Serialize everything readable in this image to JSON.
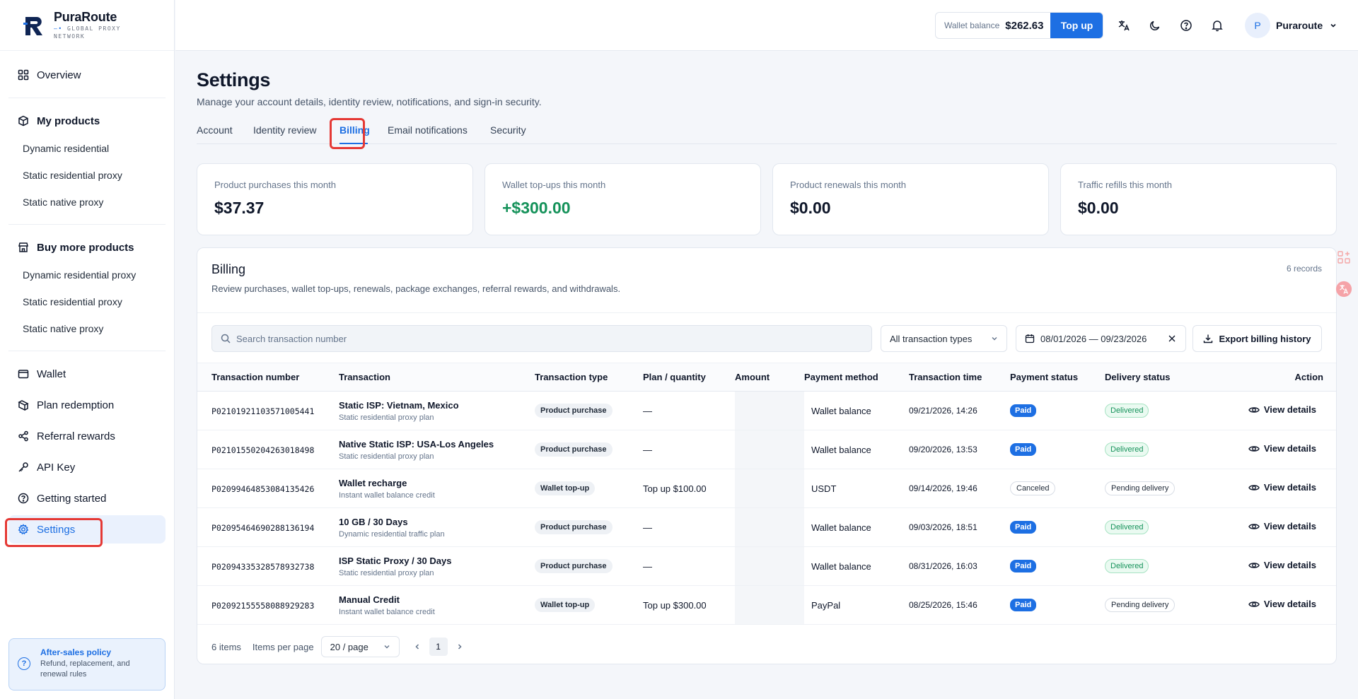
{
  "brand": {
    "name": "PuraRoute",
    "tagline_1": "GLOBAL PROXY",
    "tagline_2": "NETWORK"
  },
  "sidebar": {
    "overview": "Overview",
    "my_products": {
      "label": "My products",
      "items": [
        "Dynamic residential",
        "Static residential proxy",
        "Static native proxy"
      ]
    },
    "buy_more": {
      "label": "Buy more products",
      "items": [
        "Dynamic residential proxy",
        "Static residential proxy",
        "Static native proxy"
      ]
    },
    "wallet": "Wallet",
    "plan_redemption": "Plan redemption",
    "referral_rewards": "Referral rewards",
    "api_key": "API Key",
    "getting_started": "Getting started",
    "settings": "Settings",
    "after_sales": {
      "title": "After-sales policy",
      "desc": "Refund, replacement, and renewal rules"
    }
  },
  "topbar": {
    "wallet_label": "Wallet balance",
    "wallet_value": "$262.63",
    "topup_label": "Top up",
    "user_initial": "P",
    "user_name": "Puraroute"
  },
  "page": {
    "title": "Settings",
    "description": "Manage your account details, identity review, notifications, and sign-in security.",
    "tabs": [
      "Account",
      "Identity review",
      "Billing",
      "Email notifications",
      "Security"
    ],
    "active_tab": "Billing"
  },
  "stats": [
    {
      "label": "Product purchases this month",
      "value": "$37.37"
    },
    {
      "label": "Wallet top-ups this month",
      "value": "+$300.00"
    },
    {
      "label": "Product renewals this month",
      "value": "$0.00"
    },
    {
      "label": "Traffic refills this month",
      "value": "$0.00"
    }
  ],
  "billing": {
    "title": "Billing",
    "description": "Review purchases, wallet top-ups, renewals, package exchanges, referral rewards, and withdrawals.",
    "records": "6 records",
    "search_placeholder": "Search transaction number",
    "type_filter": "All transaction types",
    "date_range": "08/01/2026 — 09/23/2026",
    "export_label": "Export billing history",
    "columns": [
      "Transaction number",
      "Transaction",
      "Transaction type",
      "Plan / quantity",
      "Amount",
      "Payment method",
      "Transaction time",
      "Payment status",
      "Delivery status",
      "Action"
    ],
    "rows": [
      {
        "number": "P02101921103571005441",
        "name": "Static ISP: Vietnam, Mexico",
        "sub": "Static residential proxy plan",
        "type": "Product purchase",
        "plan": "—",
        "amount": "",
        "method": "Wallet balance",
        "time": "09/21/2026, 14:26",
        "pay_status": "Paid",
        "delivery": "Delivered",
        "action": "View details"
      },
      {
        "number": "P02101550204263018498",
        "name": "Native Static ISP: USA-Los Angeles",
        "sub": "Static residential proxy plan",
        "type": "Product purchase",
        "plan": "—",
        "amount": "",
        "method": "Wallet balance",
        "time": "09/20/2026, 13:53",
        "pay_status": "Paid",
        "delivery": "Delivered",
        "action": "View details"
      },
      {
        "number": "P02099464853084135426",
        "name": "Wallet recharge",
        "sub": "Instant wallet balance credit",
        "type": "Wallet top-up",
        "plan": "Top up $100.00",
        "amount": "",
        "method": "USDT",
        "time": "09/14/2026, 19:46",
        "pay_status": "Canceled",
        "delivery": "Pending delivery",
        "action": "View details"
      },
      {
        "number": "P02095464690288136194",
        "name": "10 GB / 30 Days",
        "sub": "Dynamic residential traffic plan",
        "type": "Product purchase",
        "plan": "—",
        "amount": "",
        "method": "Wallet balance",
        "time": "09/03/2026, 18:51",
        "pay_status": "Paid",
        "delivery": "Delivered",
        "action": "View details"
      },
      {
        "number": "P02094335328578932738",
        "name": "ISP Static Proxy / 30 Days",
        "sub": "Static residential proxy plan",
        "type": "Product purchase",
        "plan": "—",
        "amount": "",
        "method": "Wallet balance",
        "time": "08/31/2026, 16:03",
        "pay_status": "Paid",
        "delivery": "Delivered",
        "action": "View details"
      },
      {
        "number": "P02092155558088929283",
        "name": "Manual Credit",
        "sub": "Instant wallet balance credit",
        "type": "Wallet top-up",
        "plan": "Top up $300.00",
        "amount": "",
        "method": "PayPal",
        "time": "08/25/2026, 15:46",
        "pay_status": "Paid",
        "delivery": "Pending delivery",
        "action": "View details"
      }
    ],
    "pager": {
      "items": "6 items",
      "per_page_label": "Items per page",
      "per_page_value": "20 / page",
      "current_page": "1"
    }
  },
  "colors": {
    "accent": "#1d6fe3",
    "positive": "#15925a",
    "highlight": "#e53935"
  }
}
